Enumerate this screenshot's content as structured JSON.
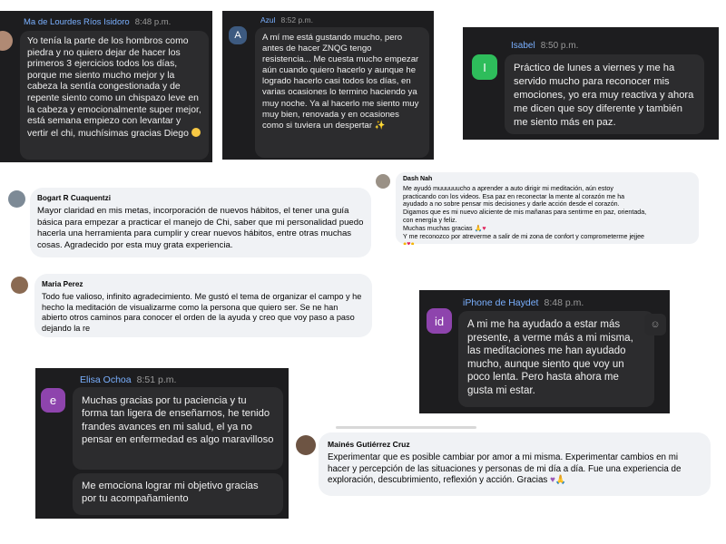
{
  "cards": {
    "c1": {
      "name": "Ma de Lourdes Ríos Isidoro",
      "time": "8:48 p.m.",
      "text": "Yo tenía la parte de los hombros como piedra y no quiero dejar de hacer los primeros 3 ejercicios todos los días, porque me siento mucho mejor y la cabeza la sentía congestionada y de repente siento como un chispazo leve en la cabeza y emocionalmente super mejor, está semana empiezo con levantar y vertir el chi, muchísimas gracias Diego"
    },
    "c2": {
      "name": "Azul",
      "time": "8:52 p.m.",
      "avatar": "A",
      "text": "A mí me está gustando mucho, pero antes de hacer ZNQG tengo resistencia... Me cuesta mucho empezar aún cuando quiero hacerlo y aunque he logrado hacerlo casi todos los días, en varias ocasiones lo termino haciendo ya muy noche. Ya al hacerlo me siento muy muy bien, renovada y en ocasiones como si tuviera un despertar"
    },
    "c3": {
      "name": "Isabel",
      "time": "8:50 p.m.",
      "avatar": "I",
      "text": "Práctico de lunes a viernes y me ha servido mucho para reconocer mis emociones, yo era muy reactiva y ahora me dicen que soy diferente y también me siento más en paz."
    },
    "c4": {
      "name": "Bogart R Cuaquentzi",
      "text": "Mayor claridad en mis metas, incorporación de nuevos hábitos, el tener una guía básica para empezar a practicar el manejo de Chi, saber que mi personalidad puedo hacerla una herramienta para cumplir y crear nuevos hábitos, entre otras muchas cosas. Agradecido por esta muy grata experiencia."
    },
    "c5": {
      "name": "Dash Nah",
      "lines": [
        "Me ayudó muuuuuucho a aprender a auto dirigir mi meditación, aún estoy",
        "practicando con los videos. Esa paz en reconectar la mente al corazón me ha",
        "ayudado a no sobre pensar mis decisiones y darle acción desde el corazón.",
        "Digamos que es mi nuevo aliciente de mis mañanas para sentirme en paz, orientada,",
        "con energía y feliz.",
        "Muchas muchas gracias",
        "Y me reconozco por atreverme a salir de mi zona de confort y comprometerme jejjee"
      ]
    },
    "c6": {
      "name": "Maria Perez",
      "text": "Todo fue valioso, infinito agradecimiento. Me gustó el tema de organizar el campo y he hecho la meditación de visualizarme como la persona que quiero ser. Se ne han abierto otros caminos para conocer el orden de la ayuda y creo que voy paso a paso dejando la re"
    },
    "c7": {
      "name": "iPhone de Haydet",
      "time": "8:48 p.m.",
      "avatar": "id",
      "text": "A mi me ha ayudado a estar más presente, a verme más a mi misma, las meditaciones  me han ayudado mucho, aunque siento que voy un poco lenta. Pero hasta ahora me gusta mi estar."
    },
    "c8": {
      "name": "Elisa Ochoa",
      "time": "8:51 p.m.",
      "avatar": "e",
      "text1": "Muchas gracias por tu paciencia y tu forma tan ligera de enseñarnos, he tenido frandes avances en mi salud, el ya no pensar en enfermedad es algo maravilloso",
      "text2": "Me emociona lograr mi objetivo gracias por tu acompañamiento"
    },
    "c9": {
      "name": "Mainés Gutiérrez Cruz",
      "text": "Experimentar que es posible cambiar por amor a mi misma. Experimentar cambios en mi hacer y percepción de las situaciones y personas de mi día a día. Fue una experiencia de exploración, descubrimiento, reflexión y acción. Gracias"
    }
  },
  "colors": {
    "dark_bg": "#1d1d1f",
    "bubble_dark": "#2c2c2e",
    "name_blue": "#7ab0ff",
    "azul_avatar": "#3d5a80",
    "isabel_avatar": "#2ebd5b",
    "haydet_avatar": "#8e44ad",
    "elisa_avatar": "#8e44ad"
  },
  "icons": {
    "reaction": "smile-icon",
    "react_button": "reaction-icon"
  }
}
